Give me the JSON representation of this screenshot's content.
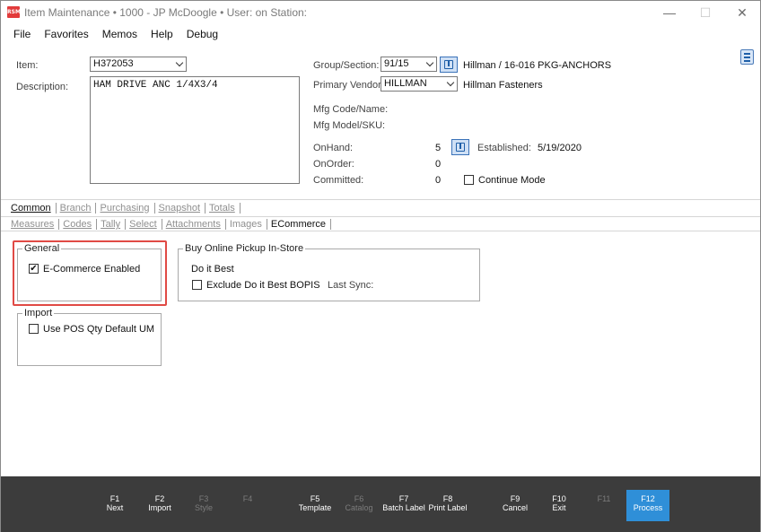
{
  "window": {
    "title": "Item Maintenance  •  1000 - JP McDoogle  •  User:            on Station:",
    "icon_text": "RSM",
    "controls": {
      "minimize": "—",
      "maximize": "☐",
      "close": "✕"
    }
  },
  "menu": [
    "File",
    "Favorites",
    "Memos",
    "Help",
    "Debug"
  ],
  "item": {
    "item_label": "Item:",
    "item_value": "H372053",
    "description_label": "Description:",
    "description_value": "HAM DRIVE ANC 1/4X3/4",
    "group_label": "Group/Section:",
    "group_value": "91/15",
    "group_name": "Hillman / 16-016 PKG-ANCHORS",
    "vendor_label": "Primary Vendor:",
    "vendor_value": "HILLMAN",
    "vendor_name": "Hillman Fasteners",
    "mfg_code_label": "Mfg Code/Name:",
    "mfg_model_label": "Mfg Model/SKU:",
    "onhand_label": "OnHand:",
    "onhand_value": "5",
    "onorder_label": "OnOrder:",
    "onorder_value": "0",
    "committed_label": "Committed:",
    "committed_value": "0",
    "established_label": "Established:",
    "established_value": "5/19/2020",
    "continue_mode_label": "Continue Mode"
  },
  "tabs_row1": [
    {
      "label": "Common",
      "active": true
    },
    {
      "label": "Branch",
      "active": false
    },
    {
      "label": "Purchasing",
      "active": false
    },
    {
      "label": "Snapshot",
      "active": false
    },
    {
      "label": "Totals",
      "active": false
    }
  ],
  "tabs_row2": [
    {
      "label": "Measures",
      "active": false
    },
    {
      "label": "Codes",
      "active": false
    },
    {
      "label": "Tally",
      "active": false
    },
    {
      "label": "Select",
      "active": false
    },
    {
      "label": "Attachments",
      "active": false
    },
    {
      "label": "Images",
      "active": false
    },
    {
      "label": "ECommerce",
      "active": true
    }
  ],
  "general": {
    "legend": "General",
    "ecommerce_enabled_label": "E-Commerce Enabled",
    "ecommerce_enabled_checked": true
  },
  "import": {
    "legend": "Import",
    "use_pos_qty_label": "Use POS Qty Default UM",
    "use_pos_qty_checked": false
  },
  "bopis": {
    "legend": "Buy Online Pickup In-Store",
    "subtitle": "Do it Best",
    "exclude_label": "Exclude Do it Best BOPIS",
    "exclude_checked": false,
    "last_sync_label": "Last Sync:"
  },
  "function_keys": [
    {
      "key": "F1",
      "label": "Next",
      "enabled": true
    },
    {
      "key": "F2",
      "label": "Import",
      "enabled": true
    },
    {
      "key": "F3",
      "label": "Style",
      "enabled": false
    },
    {
      "key": "F4",
      "label": "",
      "enabled": false
    },
    {
      "key": "F5",
      "label": "Template",
      "enabled": true
    },
    {
      "key": "F6",
      "label": "Catalog",
      "enabled": false
    },
    {
      "key": "F7",
      "label": "Batch Label",
      "enabled": true
    },
    {
      "key": "F8",
      "label": "Print Label",
      "enabled": true
    },
    {
      "key": "F9",
      "label": "Cancel",
      "enabled": true
    },
    {
      "key": "F10",
      "label": "Exit",
      "enabled": true
    },
    {
      "key": "F11",
      "label": "",
      "enabled": false
    },
    {
      "key": "F12",
      "label": "Process",
      "enabled": true,
      "primary": true
    }
  ],
  "colors": {
    "accent": "#2f8fd8",
    "footer": "#3c3c3c",
    "highlight": "#e04a45"
  }
}
